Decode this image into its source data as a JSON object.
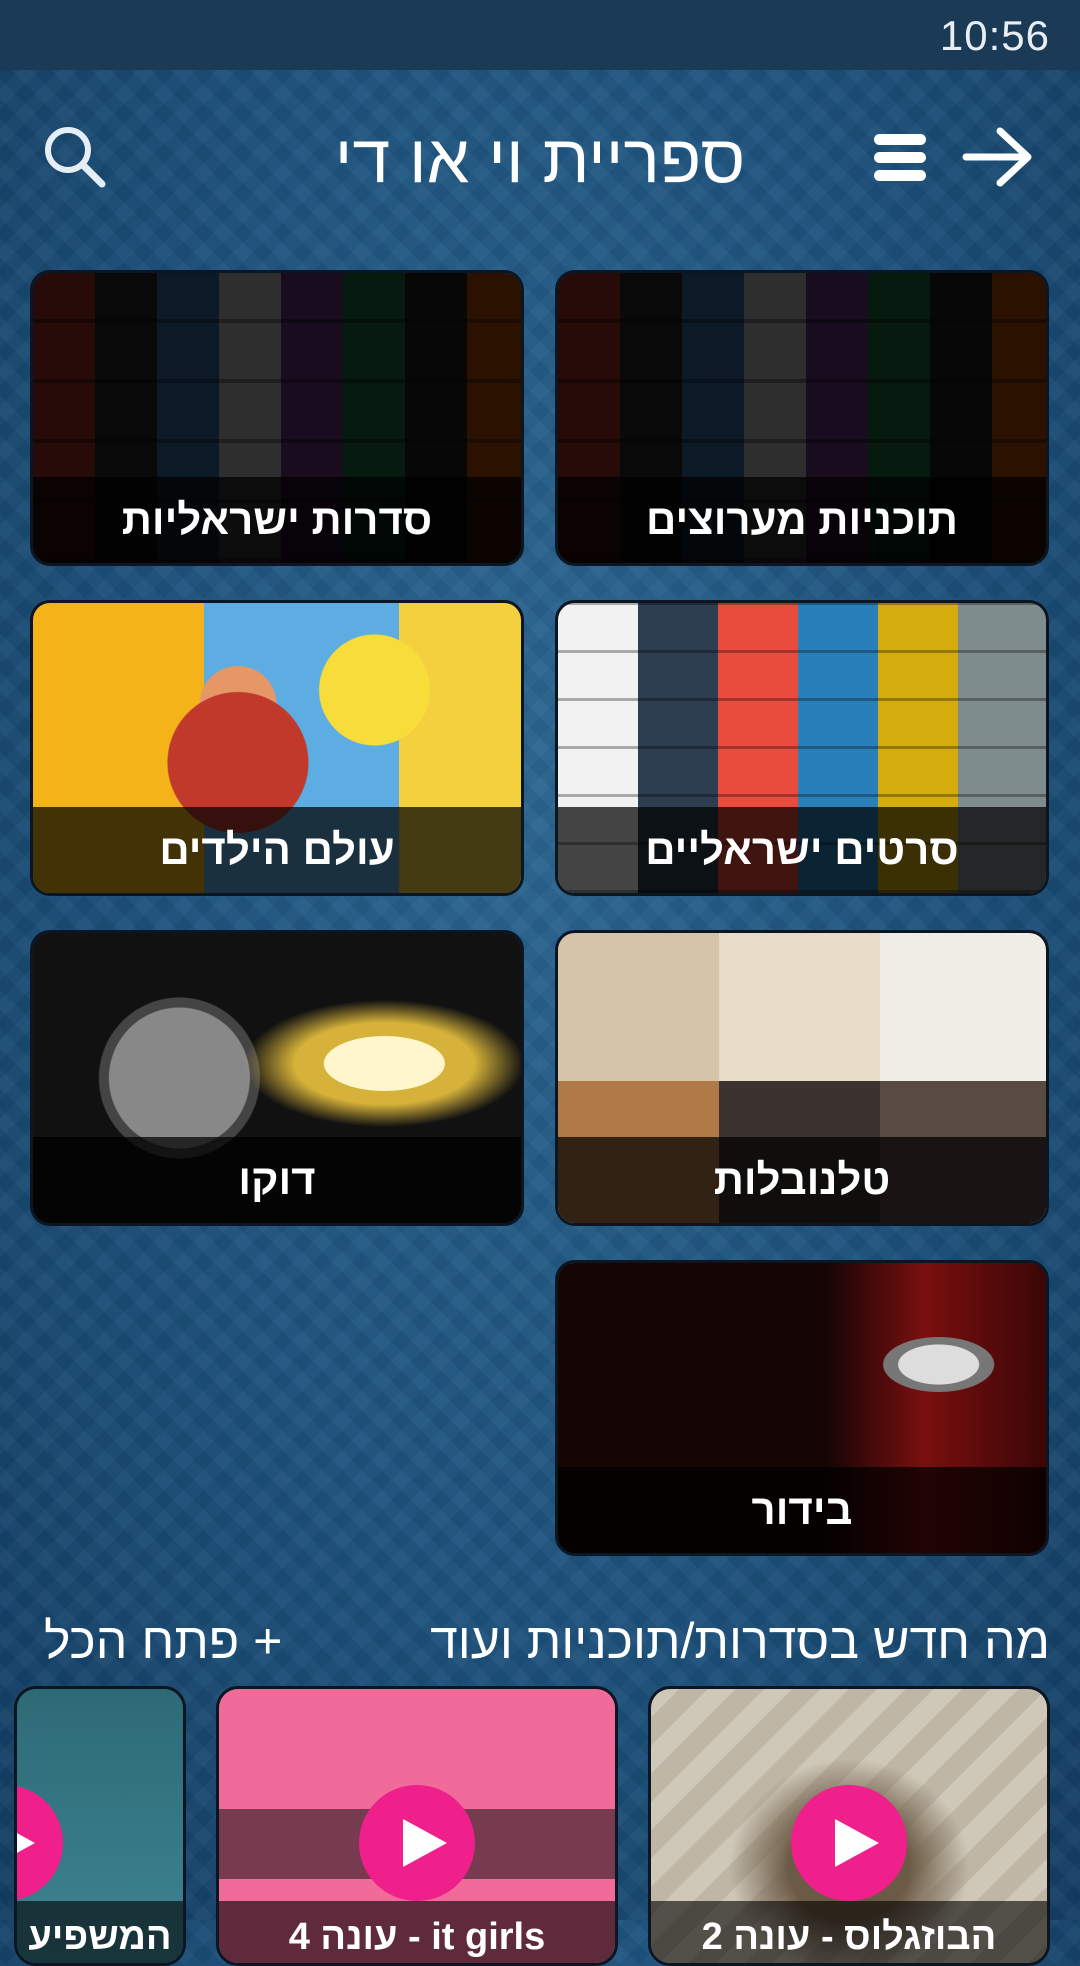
{
  "status_bar": {
    "time": "10:56"
  },
  "header": {
    "title": "ספריית וי או די",
    "icons": [
      "search-icon",
      "menu-icon",
      "arrow-right-icon"
    ]
  },
  "categories": [
    {
      "label": "תוכניות מערוצים"
    },
    {
      "label": "סדרות ישראליות"
    },
    {
      "label": "סרטים ישראליים"
    },
    {
      "label": "עולם הילדים"
    },
    {
      "label": "טלנובלות"
    },
    {
      "label": "דוקו"
    },
    {
      "label": "בידור"
    }
  ],
  "whats_new": {
    "title": "מה חדש בסדרות/תוכניות ועוד",
    "open_all": "+ פתח הכל",
    "items": [
      {
        "caption": "הבוזגלוס - עונה 2"
      },
      {
        "caption": "it girls - עונה 4"
      },
      {
        "caption": "המשפיע"
      }
    ]
  },
  "colors": {
    "accent": "#ef1f8c",
    "status_bar": "#1b3a55",
    "background": "#1f5580"
  }
}
